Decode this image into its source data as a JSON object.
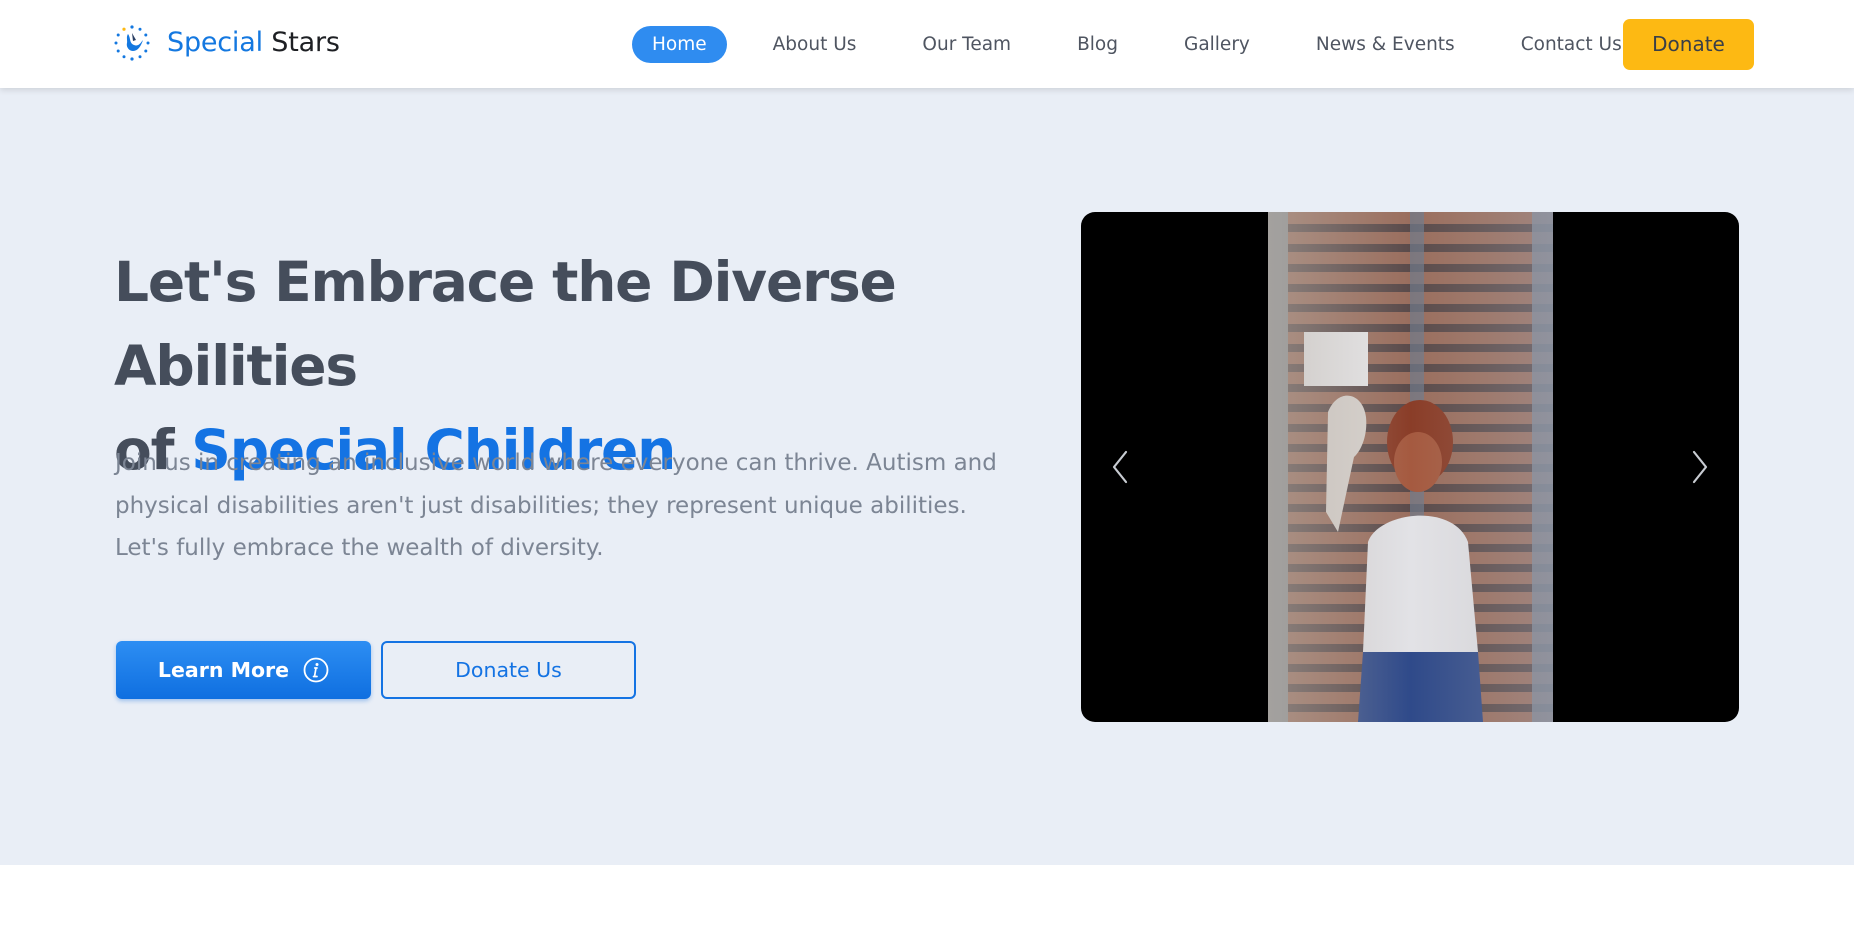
{
  "brand": {
    "name_part1": "Special",
    "name_part2": "Stars",
    "logo_icon": "bird-star-logo-icon",
    "colors": {
      "blue": "#1478e0",
      "yellow": "#fdb913",
      "dark_text": "#454d5b"
    }
  },
  "nav": {
    "items": [
      {
        "label": "Home",
        "active": true
      },
      {
        "label": "About Us",
        "active": false
      },
      {
        "label": "Our Team",
        "active": false
      },
      {
        "label": "Blog",
        "active": false
      },
      {
        "label": "Gallery",
        "active": false
      },
      {
        "label": "News & Events",
        "active": false
      },
      {
        "label": "Contact Us",
        "active": false
      }
    ],
    "donate_label": "Donate"
  },
  "hero": {
    "title_line1": "Let's Embrace the Diverse Abilities",
    "title_prefix": "of",
    "title_accent": "Special Children",
    "subtitle": "Join us in creating an inclusive world where everyone can thrive. Autism and physical disabilities aren't just disabilities; they represent unique abilities. Let's fully embrace the wealth of diversity.",
    "learn_more_label": "Learn More",
    "learn_more_icon": "info-icon",
    "donate_us_label": "Donate Us"
  },
  "slider": {
    "prev_icon": "chevron-left-icon",
    "next_icon": "chevron-right-icon"
  }
}
